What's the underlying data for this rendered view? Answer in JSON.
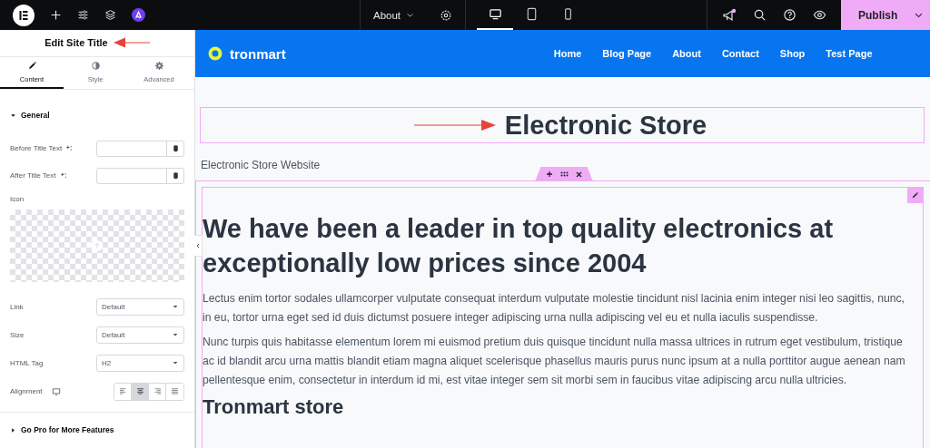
{
  "topbar": {
    "page_selector": "About",
    "devices": [
      {
        "kind": "desktop",
        "selected": true
      },
      {
        "kind": "tablet",
        "selected": false
      },
      {
        "kind": "mobile",
        "selected": false
      }
    ],
    "publish": "Publish"
  },
  "panel": {
    "title": "Edit Site Title",
    "tabs": [
      {
        "label": "Content",
        "kind": "pencil",
        "selected": true
      },
      {
        "label": "Style",
        "kind": "contrast",
        "selected": false
      },
      {
        "label": "Advanced",
        "kind": "gear",
        "selected": false
      }
    ],
    "section": {
      "label": "General",
      "expanded": true,
      "fields": [
        {
          "kind": "text",
          "label": "Before Title Text"
        },
        {
          "kind": "text",
          "label": "After Title Text"
        },
        {
          "kind": "icon",
          "label": "Icon"
        },
        {
          "kind": "select",
          "label": "Link",
          "value": "Default"
        },
        {
          "kind": "select",
          "label": "Size",
          "value": "Default"
        },
        {
          "kind": "select",
          "label": "HTML Tag",
          "value": "H2"
        },
        {
          "kind": "alignment",
          "label": "Alignment",
          "options": [
            {
              "kind": "left",
              "selected": false
            },
            {
              "kind": "center",
              "selected": true
            },
            {
              "kind": "right",
              "selected": false
            },
            {
              "kind": "justify",
              "selected": false
            }
          ]
        }
      ]
    },
    "footer_section": {
      "label": "Go Pro for More Features",
      "expanded": false
    }
  },
  "site": {
    "logo": "tronmart",
    "nav": [
      "Home",
      "Blog Page",
      "About",
      "Contact",
      "Shop",
      "Test Page"
    ],
    "site_title": "Electronic Store",
    "tagline": "Electronic Store Website",
    "heading": "We have been a leader in top quality electronics at exceptionally low prices since 2004",
    "paragraphs": [
      "Lectus enim tortor sodales ullamcorper vulputate consequat interdum vulputate molestie tincidunt nisl lacinia enim integer nisi leo sagittis, nunc, in eu, tortor urna eget sed id duis dictumst posuere integer adipiscing urna nulla adipiscing vel eu et nulla iaculis suspendisse.",
      "Nunc turpis quis habitasse elementum lorem mi euismod pretium duis quisque tincidunt nulla massa ultrices in rutrum eget vestibulum, tristique ac id blandit arcu urna mattis blandit etiam magna aliquet scelerisque phasellus mauris purus nunc ipsum at a nulla porttitor augue aenean nam pellentesque enim, consectetur in interdum id mi, est vitae integer sem sit morbi sem in faucibus vitae adipiscing arcu nulla ultricies."
    ],
    "subheading": "Tronmart store"
  }
}
